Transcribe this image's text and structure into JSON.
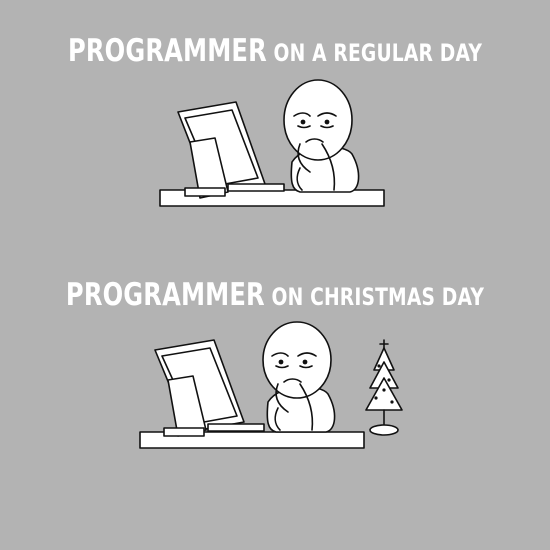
{
  "panels": [
    {
      "caption_big": "PROGRAMMER",
      "caption_rest": " ON A REGULAR DAY"
    },
    {
      "caption_big": "PROGRAMMER",
      "caption_rest": " ON CHRISTMAS DAY"
    }
  ]
}
